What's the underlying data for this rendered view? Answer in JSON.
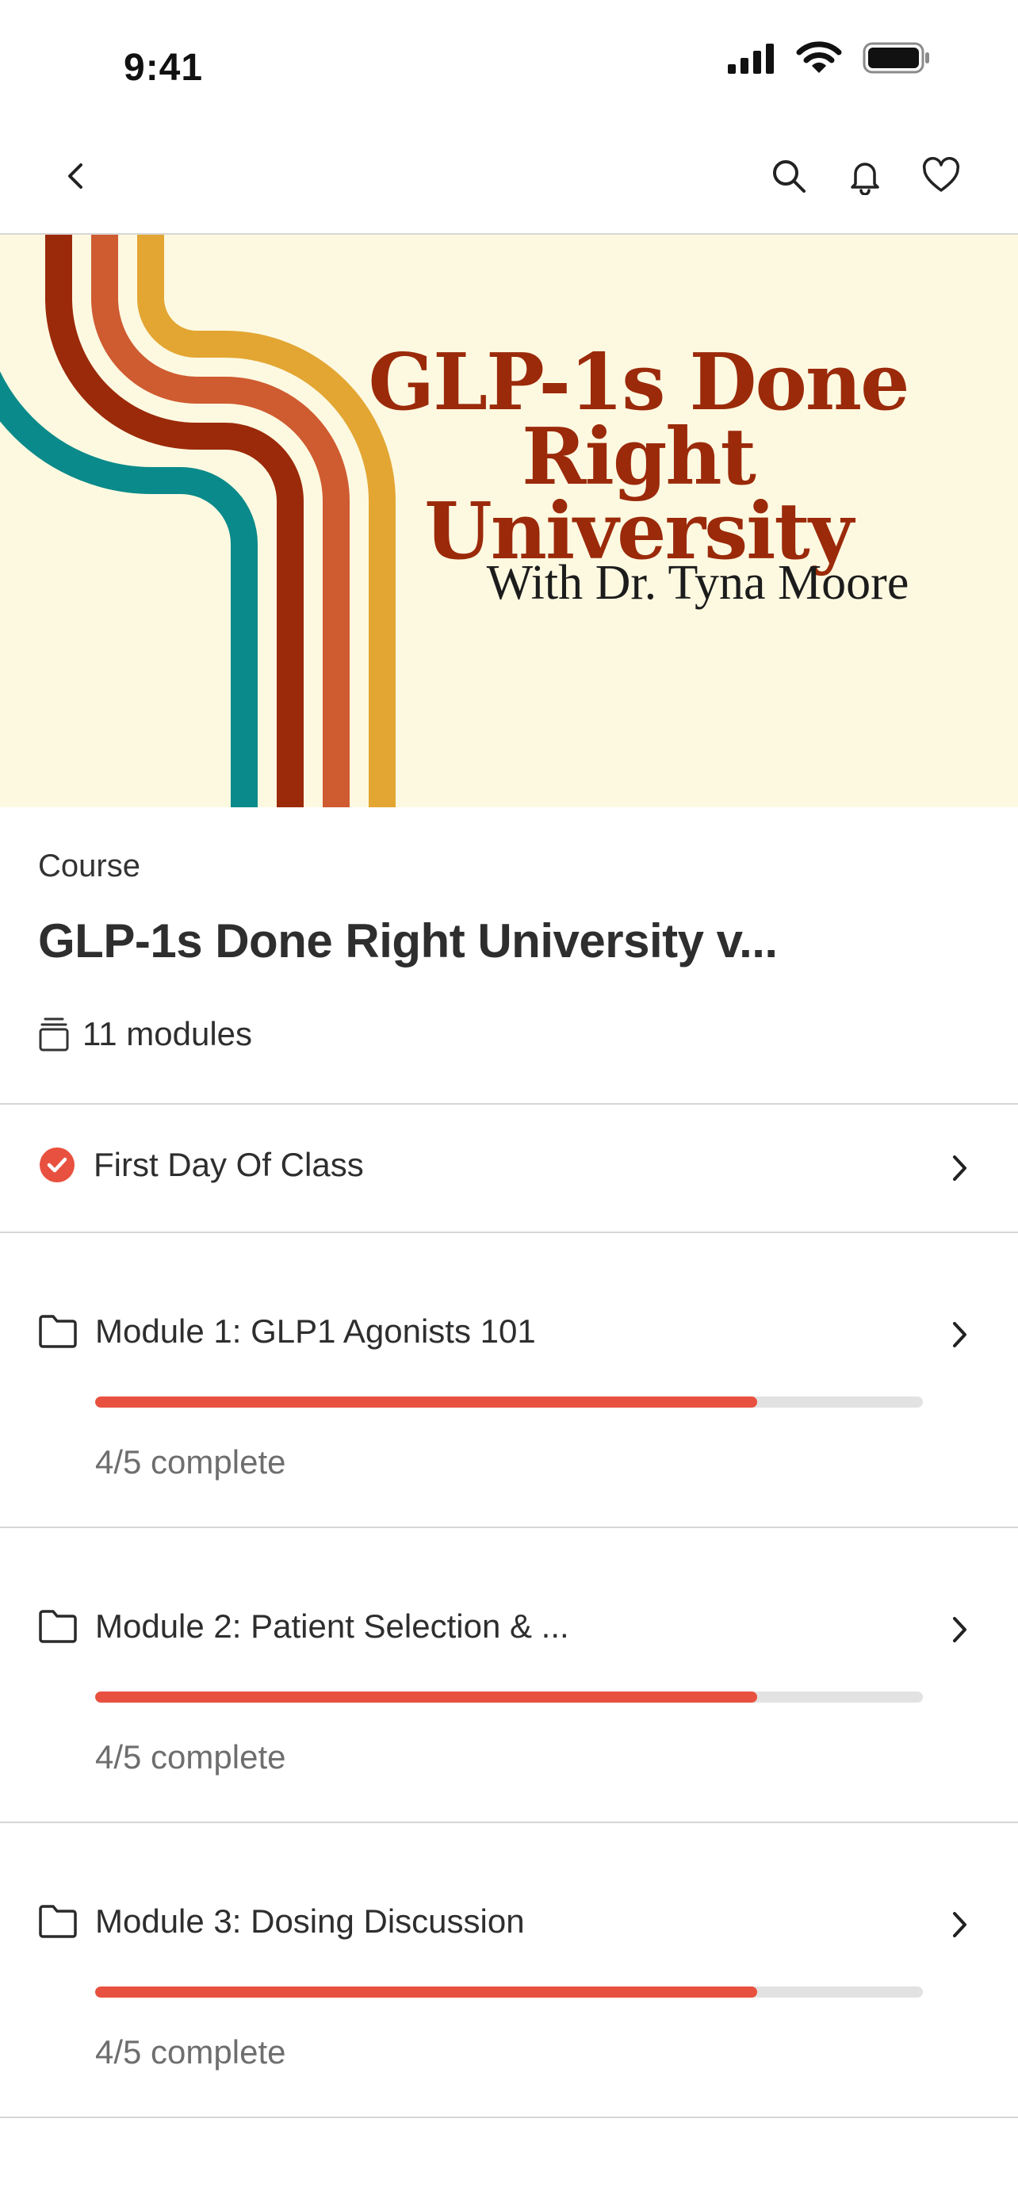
{
  "status_bar": {
    "time": "9:41"
  },
  "nav": {
    "icons": [
      "chevron-left-icon",
      "search-icon",
      "bell-icon",
      "heart-icon"
    ]
  },
  "hero": {
    "title_line1": "GLP-1s Done Right",
    "title_line2": "University",
    "subtitle": "With Dr. Tyna Moore",
    "colors": {
      "background": "#fdf9e1",
      "title": "#9b2a0a",
      "stripes": [
        "#0a8a8a",
        "#9b2a0a",
        "#cf5b30",
        "#e3a633"
      ]
    }
  },
  "course": {
    "eyebrow": "Course",
    "title": "GLP-1s Done Right University v...",
    "modules_count": "11 modules"
  },
  "items": [
    {
      "label": "First Day Of Class",
      "completed": true,
      "icon": "check-circle-icon"
    },
    {
      "label": "Module 1: GLP1 Agonists 101",
      "icon": "folder-icon",
      "progress_text": "4/5 complete",
      "progress": 0.8
    },
    {
      "label": "Module 2: Patient Selection & ...",
      "icon": "folder-icon",
      "progress_text": "4/5 complete",
      "progress": 0.8
    },
    {
      "label": "Module 3: Dosing Discussion",
      "icon": "folder-icon",
      "progress_text": "4/5 complete",
      "progress": 0.8
    }
  ],
  "accent_color": "#e8513f"
}
